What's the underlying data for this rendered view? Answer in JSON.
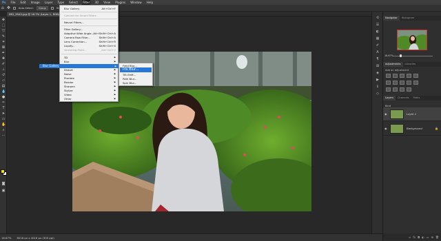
{
  "menubar": {
    "logo": "Ps",
    "items": [
      "File",
      "Edit",
      "Image",
      "Layer",
      "Type",
      "Select",
      "Filter",
      "3D",
      "View",
      "Plugins",
      "Window",
      "Help"
    ],
    "active_index": 6
  },
  "options": {
    "auto_select": "Auto-Select:",
    "group_value": "Group",
    "show_transform": "Show Transform Controls"
  },
  "document": {
    "tab_title": "IMG_9545.jpg @ 16.7% (Layer 1, RGB/8*)",
    "zoom_status": "16.67%",
    "dimensions_status": "6016 px x 4016 px (300 ppi)"
  },
  "filter_menu": {
    "items": [
      {
        "label": "Blur Gallery",
        "shortcut": "Alt+Ctrl+F",
        "disabled": false
      },
      {
        "sep": true
      },
      {
        "label": "Convert for Smart Filters",
        "disabled": true
      },
      {
        "sep": true
      },
      {
        "label": "Neural Filters...",
        "disabled": false
      },
      {
        "sep": true
      },
      {
        "label": "Filter Gallery...",
        "disabled": false
      },
      {
        "label": "Adaptive Wide Angle...",
        "shortcut": "Alt+Shift+Ctrl+A",
        "disabled": false
      },
      {
        "label": "Camera Raw Filter...",
        "shortcut": "Shift+Ctrl+A",
        "disabled": false
      },
      {
        "label": "Lens Correction...",
        "shortcut": "Shift+Ctrl+R",
        "disabled": false
      },
      {
        "label": "Liquify...",
        "shortcut": "Shift+Ctrl+X",
        "disabled": false
      },
      {
        "label": "Vanishing Point...",
        "shortcut": "Alt+Ctrl+V",
        "disabled": true
      },
      {
        "sep": true
      },
      {
        "label": "3D",
        "sub": true
      },
      {
        "label": "Blur",
        "sub": true
      },
      {
        "label": "Blur Gallery",
        "sub": true,
        "highlight": true
      },
      {
        "label": "Distort",
        "sub": true
      },
      {
        "label": "Noise",
        "sub": true
      },
      {
        "label": "Pixelate",
        "sub": true
      },
      {
        "label": "Render",
        "sub": true
      },
      {
        "label": "Sharpen",
        "sub": true
      },
      {
        "label": "Stylize",
        "sub": true
      },
      {
        "label": "Video",
        "sub": true
      },
      {
        "label": "Other",
        "sub": true
      }
    ]
  },
  "blur_gallery_submenu": {
    "items": [
      "Field Blur...",
      "Iris Blur...",
      "Tilt-Shift...",
      "Path Blur...",
      "Spin Blur..."
    ],
    "highlight_index": 1
  },
  "panels": {
    "navigator_tabs": [
      "Navigator",
      "Histogram"
    ],
    "navigator_zoom": "16.67%",
    "adjustments_tabs": [
      "Adjustments",
      "Libraries"
    ],
    "add_adjustment": "Add an adjustment",
    "layers_tabs": [
      "Layers",
      "Channels",
      "Paths"
    ],
    "kind_label": "Kind",
    "blend_mode": "Normal",
    "opacity_label": "Opacity:",
    "opacity_value": "100%",
    "lock_label": "Lock:",
    "fill_label": "Fill:",
    "fill_value": "100%",
    "layers": [
      {
        "name": "Layer 1",
        "selected": true
      },
      {
        "name": "Background",
        "selected": false
      }
    ]
  },
  "colors": {
    "foreground": "#f6e400",
    "background": "#ffffff",
    "menu_highlight": "#2877d6"
  }
}
